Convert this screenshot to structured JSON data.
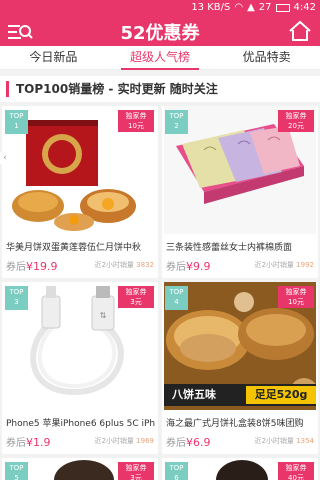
{
  "status": {
    "left": "",
    "speed": "13 KB/S",
    "battery": "27",
    "time": "4:42"
  },
  "appbar": {
    "title": "52优惠券"
  },
  "tabs": [
    "今日新品",
    "超级人气榜",
    "优品特卖"
  ],
  "section": {
    "title": "TOP100销量榜 - 实时更新 随时关注"
  },
  "items": [
    {
      "rank": "TOP\n1",
      "badge": "独家券\n10元",
      "name": "华美月饼双蛋黄莲蓉伍仁月饼中秋",
      "price_prefix": "券后",
      "price": "¥19.9",
      "sales_label": "近2小时销量",
      "sales": "3832"
    },
    {
      "rank": "TOP\n2",
      "badge": "独家券\n20元",
      "name": "三条装性感蕾丝女士内裤棉质面",
      "price_prefix": "券后",
      "price": "¥9.9",
      "sales_label": "近2小时销量",
      "sales": "1992"
    },
    {
      "rank": "TOP\n3",
      "badge": "独家券\n3元",
      "name": "Phone5 苹果iPhone6 6plus 5C iPh",
      "price_prefix": "券后",
      "price": "¥1.9",
      "sales_label": "近2小时销量",
      "sales": "1969"
    },
    {
      "rank": "TOP\n4",
      "badge": "独家券\n10元",
      "name": "海之最广式月饼礼盒装8饼5味团购",
      "price_prefix": "券后",
      "price": "¥6.9",
      "sales_label": "近2小时销量",
      "sales": "1354",
      "overlay_left": "八饼五味",
      "overlay_right": "足足520g"
    },
    {
      "rank": "TOP\n5",
      "badge": "独家券\n3元"
    },
    {
      "rank": "TOP\n6",
      "badge": "独家券\n40元"
    }
  ],
  "colors": {
    "brand": "#e9366a",
    "rank_badge": "#7ccdc1"
  }
}
